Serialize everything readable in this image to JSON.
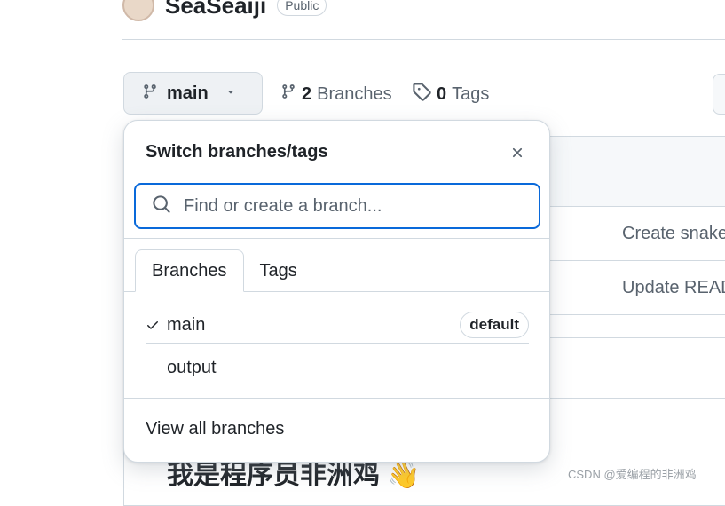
{
  "repo": {
    "name": "SeaSeaiji",
    "visibility": "Public"
  },
  "branch_selector": {
    "current": "main"
  },
  "stats": {
    "branches_count": "2",
    "branches_label": "Branches",
    "tags_count": "0",
    "tags_label": "Tags"
  },
  "files": [
    {
      "commit_message": "Create snake"
    },
    {
      "commit_message": "Update READ"
    }
  ],
  "readme": {
    "title": "我是程序员非洲鸡 👋"
  },
  "watermark": "CSDN @爱编程的非洲鸡",
  "dropdown": {
    "title": "Switch branches/tags",
    "search": {
      "placeholder": "Find or create a branch...",
      "value": ""
    },
    "tabs": [
      {
        "label": "Branches",
        "active": true
      },
      {
        "label": "Tags",
        "active": false
      }
    ],
    "branches": [
      {
        "name": "main",
        "selected": true,
        "badge": "default"
      },
      {
        "name": "output",
        "selected": false,
        "badge": ""
      }
    ],
    "footer": "View all branches"
  },
  "colors": {
    "accent": "#0969da",
    "border": "#d1d9e0",
    "muted": "#59636e",
    "button_bg": "#eef1f4"
  },
  "icons": [
    "git-branch-icon",
    "caret-down-icon",
    "tag-icon",
    "search-icon",
    "close-icon",
    "check-icon"
  ]
}
